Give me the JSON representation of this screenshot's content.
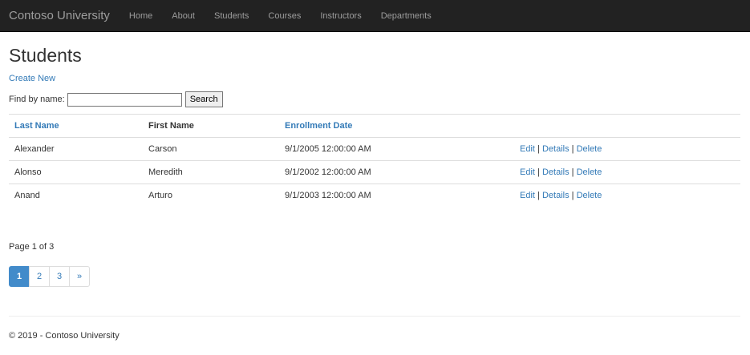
{
  "navbar": {
    "brand": "Contoso University",
    "items": [
      {
        "label": "Home"
      },
      {
        "label": "About"
      },
      {
        "label": "Students"
      },
      {
        "label": "Courses"
      },
      {
        "label": "Instructors"
      },
      {
        "label": "Departments"
      }
    ]
  },
  "page": {
    "title": "Students",
    "create_new": "Create New",
    "find_label": "Find by name:",
    "search_value": "",
    "search_button": "Search"
  },
  "table": {
    "headers": {
      "last_name": "Last Name",
      "first_name": "First Name",
      "enrollment_date": "Enrollment Date"
    },
    "rows": [
      {
        "last_name": "Alexander",
        "first_name": "Carson",
        "enrollment_date": "9/1/2005 12:00:00 AM"
      },
      {
        "last_name": "Alonso",
        "first_name": "Meredith",
        "enrollment_date": "9/1/2002 12:00:00 AM"
      },
      {
        "last_name": "Anand",
        "first_name": "Arturo",
        "enrollment_date": "9/1/2003 12:00:00 AM"
      }
    ],
    "actions": {
      "edit": "Edit",
      "details": "Details",
      "delete": "Delete",
      "separator": "|"
    }
  },
  "pagination": {
    "info": "Page 1 of 3",
    "pages": [
      "1",
      "2",
      "3"
    ],
    "next": "»",
    "active_page": "1"
  },
  "footer": {
    "text": "© 2019 - Contoso University"
  },
  "colors": {
    "navbar_bg": "#222222",
    "link": "#337ab7",
    "active_page_bg": "#428bca"
  }
}
